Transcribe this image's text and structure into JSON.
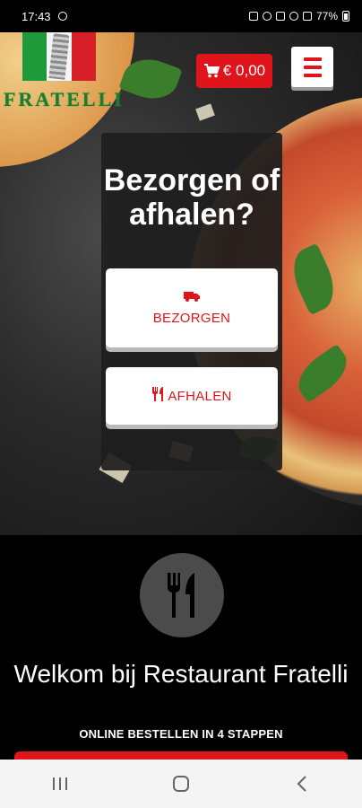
{
  "status": {
    "time": "17:43",
    "battery": "77%"
  },
  "brand": {
    "name": "FRATELLI"
  },
  "header": {
    "cart_total": "€ 0,00"
  },
  "order_dialog": {
    "title": "Bezorgen of afhalen?",
    "delivery_label": "BEZORGEN",
    "pickup_label": "AFHALEN"
  },
  "welcome": {
    "title": "Welkom bij Restaurant Fratelli",
    "subtitle": "ONLINE BESTELLEN IN 4 STAPPEN"
  },
  "colors": {
    "accent_red": "#e0141b",
    "card_dark": "#1e1e1e"
  },
  "icons": {
    "cart": "cart-icon",
    "menu": "hamburger-menu-icon",
    "delivery": "truck-icon",
    "pickup": "fork-knife-icon",
    "welcome": "cutlery-icon"
  }
}
